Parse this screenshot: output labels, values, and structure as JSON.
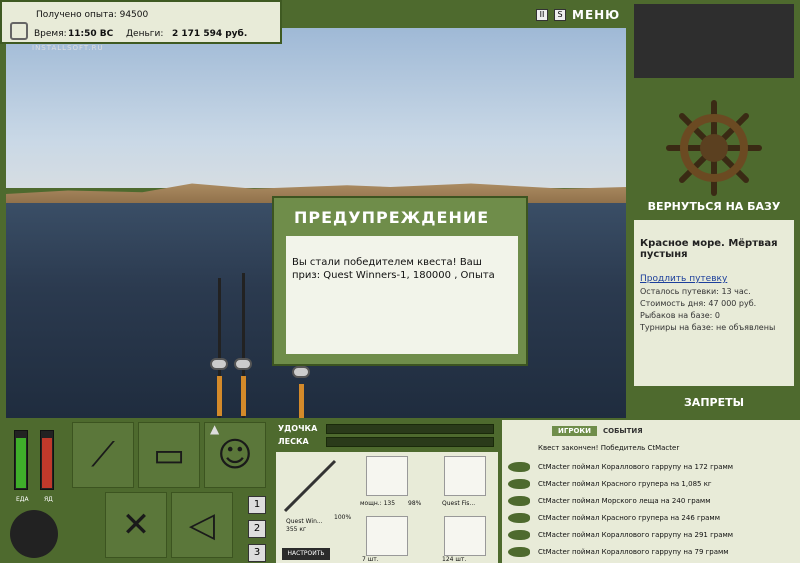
{
  "status": {
    "xp_label": "Получено опыта: 94500",
    "time_label": "Время:",
    "time_value": "11:50 ВС",
    "money_label": "Деньги:",
    "money_value": "2 171 594 руб.",
    "watermark": "INSTALLSOFT.RU"
  },
  "top_controls": {
    "pause": "II",
    "sound": "S",
    "menu": "МЕНЮ"
  },
  "right_panel": {
    "return_label": "ВЕРНУТЬСЯ НА БАЗУ",
    "location_title": "Красное море. Мёртвая пустыня",
    "extend_link": "Продлить путевку",
    "lines": [
      "Осталось путевки: 13 час.",
      "Стоимость дня: 47 000 руб.",
      "Рыбаков на базе: 0",
      "Турниры на базе: не объявлены"
    ],
    "bans_label": "ЗАПРЕТЫ"
  },
  "dialog": {
    "title": "ПРЕДУПРЕЖДЕНИЕ",
    "message": "Вы стали победителем квеста! Ваш приз: Quest Winners-1, 180000 , Опыта"
  },
  "meters": {
    "food_label": "ЕДА",
    "poison_label": "ЯД",
    "food_level": 0.9,
    "poison_level": 0.9
  },
  "pages": [
    "1",
    "2",
    "3"
  ],
  "gear": {
    "rod_label": "УДОЧКА",
    "line_label": "ЛЕСКА",
    "rod_name": "Quest Win...",
    "rod_weight": "355 кг",
    "rod_percent": "100%",
    "reel_caption": "мощн.: 135",
    "reel_percent": "98%",
    "line_caption": "Quest Fis...",
    "hook_caption": "7 шт.",
    "bait_caption": "124 шт.",
    "settings_label": "НАСТРОИТЬ"
  },
  "log": {
    "tab_players": "ИГРОКИ",
    "tab_events": "СОБЫТИЯ",
    "quest_line": "Квест закончен! Победитель CtMacter",
    "items": [
      "CtMacter поймал Кораллового гаррупу на 172 грамм",
      "CtMacter поймал Красного групера на 1,085 кг",
      "CtMacter поймал Морского леща на 240 грамм",
      "CtMacter поймал Красного групера на 246 грамм",
      "CtMacter поймал Кораллового гаррупу на 291 грамм",
      "CtMacter поймал Кораллового гаррупу на 79 грамм"
    ]
  }
}
